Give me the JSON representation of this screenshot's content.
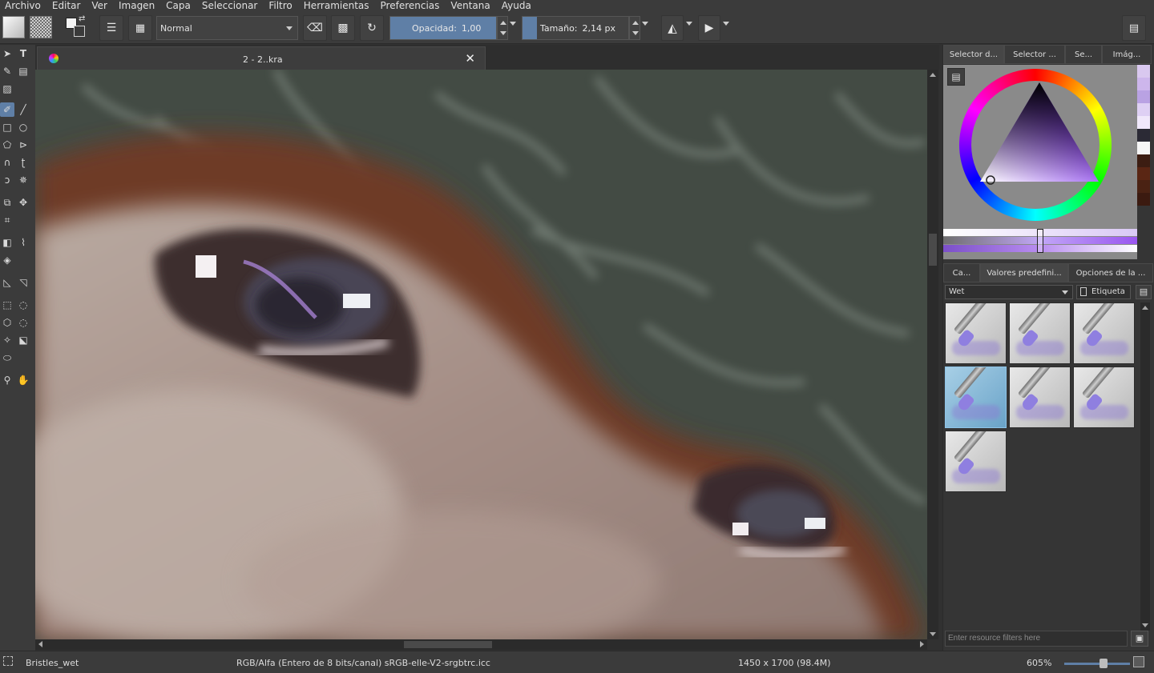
{
  "menu": [
    "Archivo",
    "Editar",
    "Ver",
    "Imagen",
    "Capa",
    "Seleccionar",
    "Filtro",
    "Herramientas",
    "Preferencias",
    "Ventana",
    "Ayuda"
  ],
  "toolbar": {
    "blend_mode": "Normal",
    "opacity_label": "Opacidad:",
    "opacity_value": "1,00",
    "opacity_fraction": 1.0,
    "size_label": "Tamaño:",
    "size_value": "2,14 px"
  },
  "document": {
    "tab_title": "2 - 2..kra"
  },
  "dock": {
    "top_tabs": [
      "Selector d...",
      "Selector ...",
      "Se...",
      "Imág..."
    ],
    "preset_tabs": [
      "Ca...",
      "Valores predefini...",
      "Opciones de la ..."
    ],
    "preset_group": "Wet",
    "tag_label": "Etiqueta",
    "filter_placeholder": "Enter resource filters here",
    "selected_preset_index": 3,
    "swatches": [
      "#d9c8ef",
      "#cdb6ec",
      "#b9a2e3",
      "#ded0f4",
      "#f0e8fb",
      "#2b2a35",
      "#f6f6f6",
      "#3c1d12",
      "#5a2614",
      "#4a2213",
      "#3b1a10"
    ]
  },
  "status": {
    "preset_name": "Bristles_wet",
    "color_space": "RGB/Alfa (Entero de 8 bits/canal)  sRGB-elle-V2-srgbtrc.icc",
    "dimensions": "1450 x 1700 (98.4M)",
    "zoom": "605%"
  }
}
